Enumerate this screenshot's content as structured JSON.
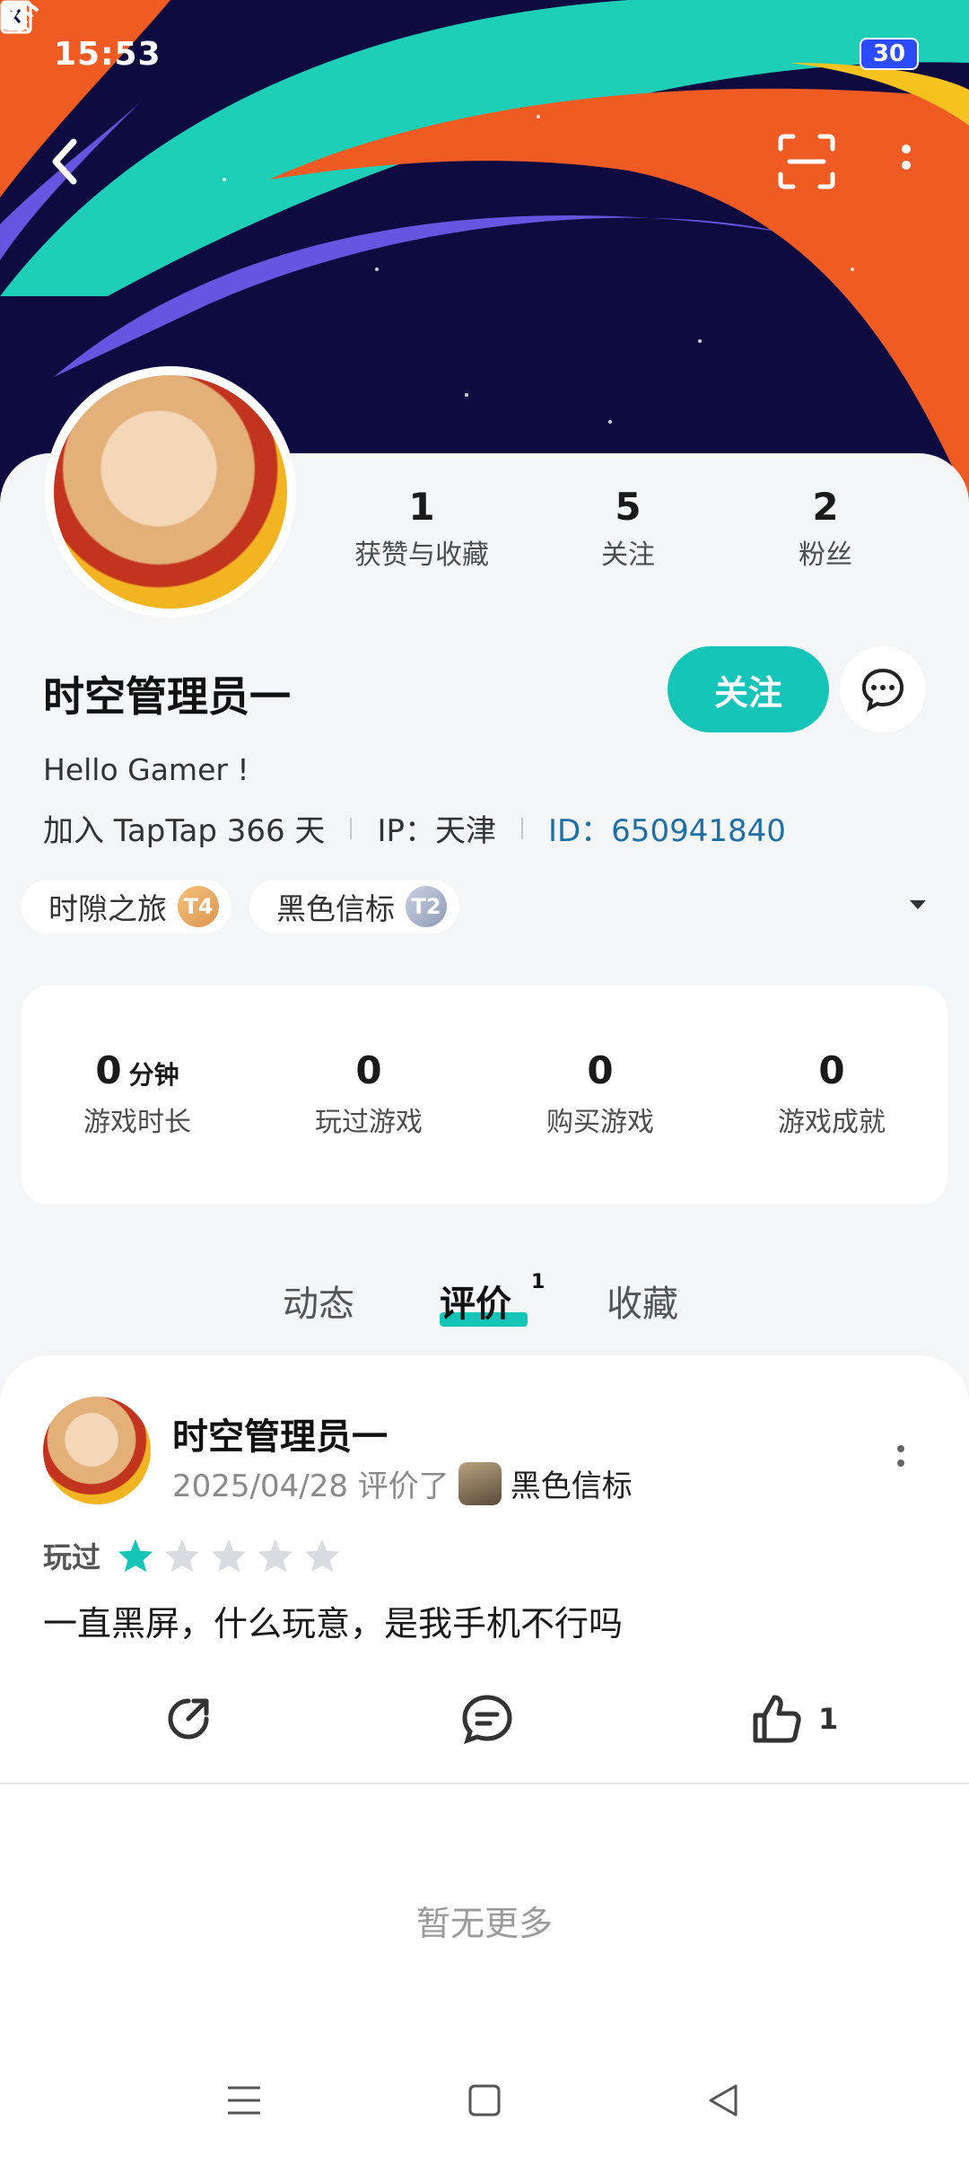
{
  "status": {
    "time": "15:53",
    "battery": "30"
  },
  "profile": {
    "stats": [
      {
        "value": "1",
        "label": "获赞与收藏"
      },
      {
        "value": "5",
        "label": "关注"
      },
      {
        "value": "2",
        "label": "粉丝"
      }
    ],
    "username": "时空管理员一",
    "follow_label": "关注",
    "bio": "Hello Gamer !",
    "joined": "加入 TapTap 366 天",
    "ip": "IP：天津",
    "id": "ID：650941840",
    "badges": [
      {
        "label": "时隙之旅",
        "level": "T4"
      },
      {
        "label": "黑色信标",
        "level": "T2"
      }
    ]
  },
  "game_stats": [
    {
      "value": "0",
      "unit": "分钟",
      "label": "游戏时长"
    },
    {
      "value": "0",
      "unit": "",
      "label": "玩过游戏"
    },
    {
      "value": "0",
      "unit": "",
      "label": "购买游戏"
    },
    {
      "value": "0",
      "unit": "",
      "label": "游戏成就"
    }
  ],
  "tabs": [
    {
      "label": "动态"
    },
    {
      "label": "评价",
      "count": "1",
      "active": true
    },
    {
      "label": "收藏"
    }
  ],
  "review": {
    "author": "时空管理员一",
    "date_action": "2025/04/28 评价了",
    "game": "黑色信标",
    "played_label": "玩过",
    "rating": 1,
    "max_rating": 5,
    "text": "一直黑屏，什么玩意，是我手机不行吗",
    "like_count": "1"
  },
  "footer": {
    "no_more": "暂无更多"
  },
  "colors": {
    "accent": "#15c5b8",
    "id_link": "#1d6fa5",
    "banner_bg": "#0d0b3f"
  }
}
